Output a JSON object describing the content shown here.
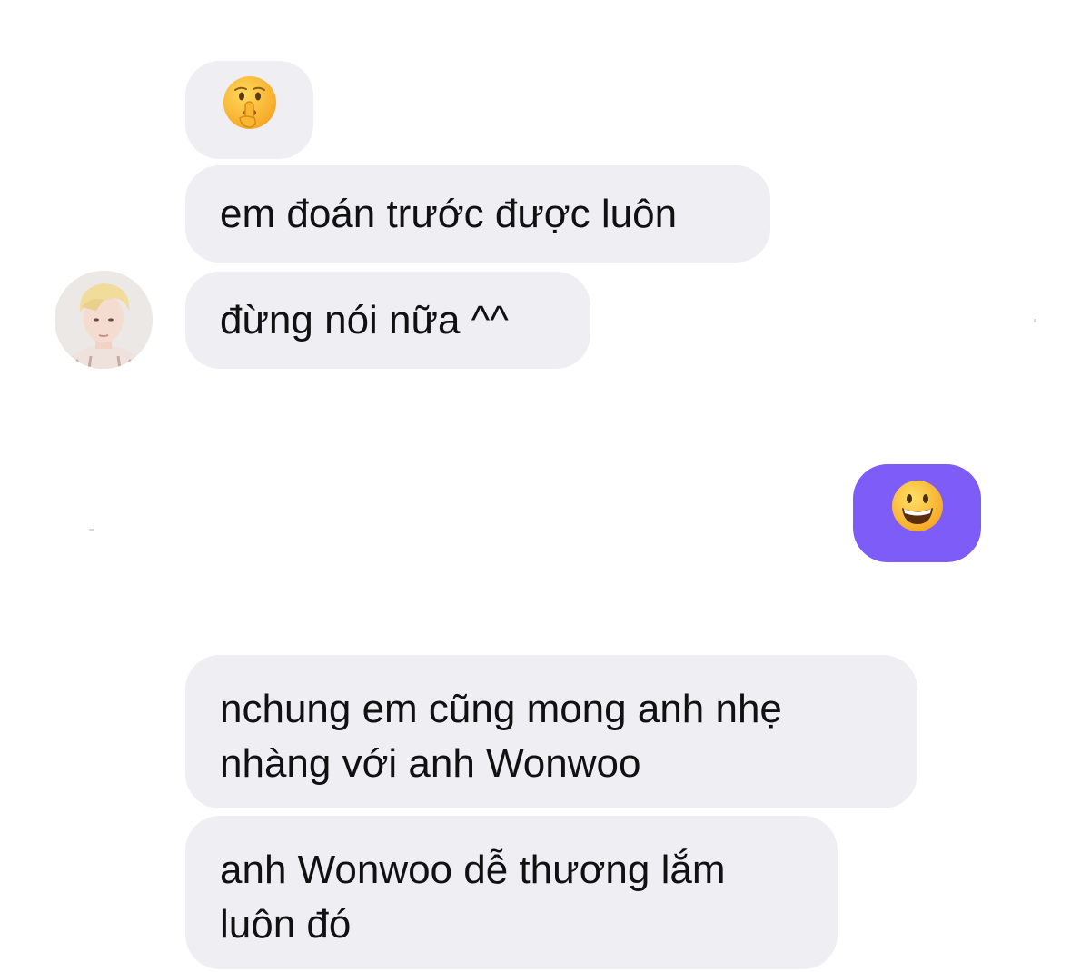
{
  "conversation": {
    "messages": [
      {
        "sender": "contact",
        "type": "emoji",
        "icon": "shushing-face-emoji"
      },
      {
        "sender": "contact",
        "type": "text",
        "text": "em đoán trước được luôn"
      },
      {
        "sender": "contact",
        "type": "text",
        "text": "đừng nói nữa ^^",
        "with_avatar": true
      },
      {
        "sender": "me",
        "type": "emoji",
        "icon": "grinning-face-emoji"
      },
      {
        "sender": "contact",
        "type": "text",
        "lines": [
          "nchung em cũng mong anh nhẹ",
          "nhàng với anh Wonwoo"
        ]
      },
      {
        "sender": "contact",
        "type": "text",
        "lines": [
          "anh Wonwoo dễ thương lắm",
          "luôn đó"
        ]
      }
    ]
  },
  "colors": {
    "incoming_bubble": "#efeef3",
    "outgoing_bubble": "#7e5cf7",
    "text": "#111111",
    "emoji_yellow": "#fbc43a"
  }
}
